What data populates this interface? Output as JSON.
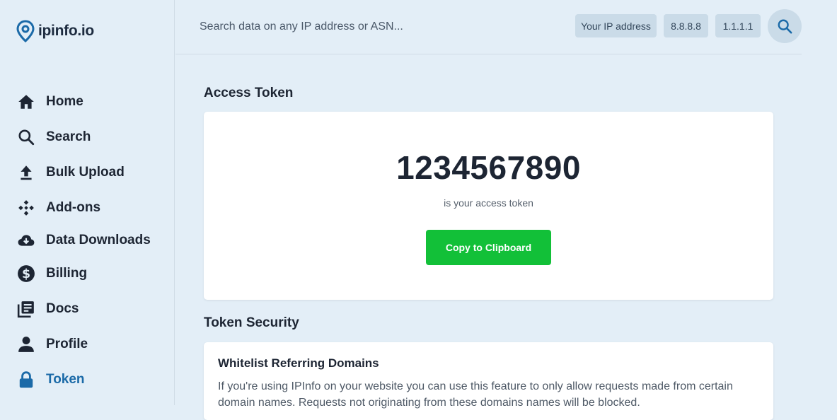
{
  "brand": {
    "name": "ipinfo.io",
    "logo_icon": "location-pin-icon",
    "color": "#1b6aa8"
  },
  "sidebar": {
    "items": [
      {
        "label": "Home",
        "icon": "home-icon"
      },
      {
        "label": "Search",
        "icon": "search-icon"
      },
      {
        "label": "Bulk Upload",
        "icon": "upload-icon"
      },
      {
        "label": "Add-ons",
        "icon": "addons-icon"
      },
      {
        "label": "Data Downloads",
        "icon": "cloud-download-icon"
      },
      {
        "label": "Billing",
        "icon": "dollar-icon"
      },
      {
        "label": "Docs",
        "icon": "docs-icon"
      },
      {
        "label": "Profile",
        "icon": "person-icon"
      },
      {
        "label": "Token",
        "icon": "lock-icon",
        "active": true
      }
    ]
  },
  "header": {
    "search_placeholder": "Search data on any IP address or ASN...",
    "quick_links": [
      "Your IP address",
      "8.8.8.8",
      "1.1.1.1"
    ],
    "search_button_icon": "search-icon"
  },
  "access_token": {
    "title": "Access Token",
    "value": "1234567890",
    "caption": "is your access token",
    "copy_label": "Copy to Clipboard"
  },
  "token_security": {
    "title": "Token Security",
    "whitelist": {
      "heading": "Whitelist Referring Domains",
      "description": "If you're using IPInfo on your website you can use this feature to only allow requests made from certain domain names. Requests not originating from these domains names will be blocked."
    }
  },
  "colors": {
    "background": "#e3eef7",
    "active_nav": "#1b6aa8",
    "copy_button": "#12c038",
    "chip": "#cadbe8"
  }
}
